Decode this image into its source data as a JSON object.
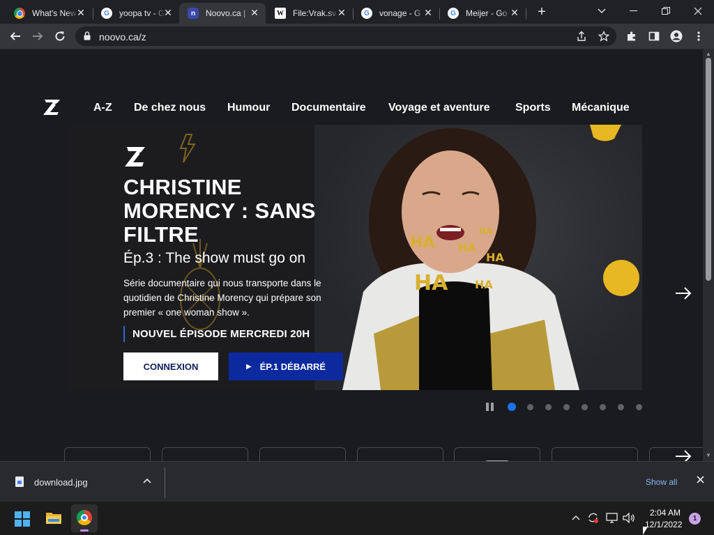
{
  "browser": {
    "tabs": [
      {
        "title": "What's New",
        "favicon": "chrome-icon"
      },
      {
        "title": "yoopa tv - G",
        "favicon": "google-icon"
      },
      {
        "title": "Noovo.ca |",
        "favicon": "noovo-icon",
        "active": true
      },
      {
        "title": "File:Vrak.sv",
        "favicon": "wikipedia-icon"
      },
      {
        "title": "vonage - G",
        "favicon": "google-icon"
      },
      {
        "title": "Meijer - Go",
        "favicon": "google-icon"
      }
    ],
    "tab_close_glyph": "✕",
    "new_tab_glyph": "+",
    "url": "noovo.ca/z",
    "colors": {
      "frame": "#202124",
      "toolbar": "#35363a",
      "link": "#8ab4f8"
    }
  },
  "site": {
    "nav": [
      "A-Z",
      "De chez nous",
      "Humour",
      "Documentaire",
      "Voyage et aventure",
      "Sports",
      "Mécanique"
    ],
    "hero": {
      "title": "CHRISTINE MORENCY : SANS FILTRE",
      "episode": "Ép.3 : The show must go on",
      "description": "Série documentaire qui nous transporte dans le quotidien de Christine Morency qui prépare son premier « one woman show ».",
      "airing": "NOUVEL ÉPISODE MERCREDI 20H",
      "login_label": "CONNEXION",
      "watch_label": "ÉP.1 DÉBARRÉ",
      "ha_text": "HA",
      "colors": {
        "watch_button": "#0c2a9e",
        "airing_bar": "#2b6cd6",
        "accent_yellow": "#d9b02e"
      }
    },
    "carousel": {
      "slides": 8,
      "active_index": 0,
      "dot_active_color": "#1a73e8"
    }
  },
  "downloads": {
    "file_name": "download.jpg",
    "show_all_label": "Show all"
  },
  "taskbar": {
    "time": "2:04 AM",
    "date": "12/1/2022",
    "notifications": "1"
  }
}
